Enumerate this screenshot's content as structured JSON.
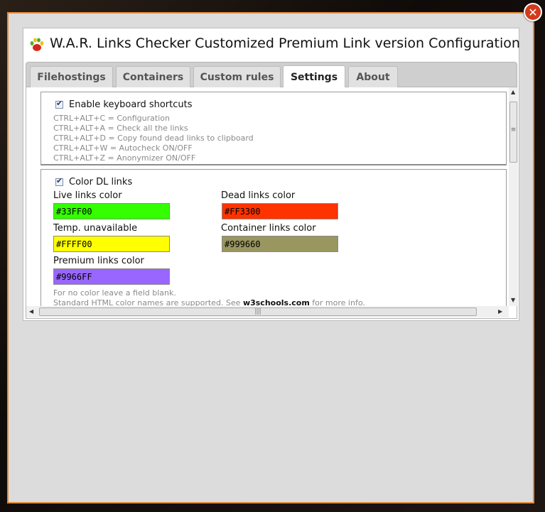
{
  "window": {
    "title": "W.A.R. Links Checker Customized Premium Link version Configuration",
    "close_label": "✕"
  },
  "tabs": [
    {
      "label": "Filehostings",
      "active": false
    },
    {
      "label": "Containers",
      "active": false
    },
    {
      "label": "Custom rules",
      "active": false
    },
    {
      "label": "Settings",
      "active": true
    },
    {
      "label": "About",
      "active": false
    }
  ],
  "settings": {
    "keyboard": {
      "label": "Enable keyboard shortcuts",
      "checked": true,
      "shortcuts": [
        "CTRL+ALT+C = Configuration",
        "CTRL+ALT+A = Check all the links",
        "CTRL+ALT+D = Copy found dead links to clipboard",
        "CTRL+ALT+W = Autocheck ON/OFF",
        "CTRL+ALT+Z = Anonymizer ON/OFF"
      ]
    },
    "color": {
      "label": "Color DL links",
      "checked": true,
      "live_label": "Live links color",
      "live_value": "#33FF00",
      "dead_label": "Dead links color",
      "dead_value": "#FF3300",
      "temp_label": "Temp. unavailable",
      "temp_value": "#FFFF00",
      "container_label": "Container links color",
      "container_value": "#999660",
      "premium_label": "Premium links color",
      "premium_value": "#9966FF",
      "note1": "For no color leave a field blank.",
      "note2_prefix": "Standard HTML color names are supported. See ",
      "note2_link": "w3schools.com",
      "note2_suffix": " for more info."
    }
  },
  "colors": {
    "frame_border": "#e08a3c",
    "close_button": "#d33a1c"
  }
}
